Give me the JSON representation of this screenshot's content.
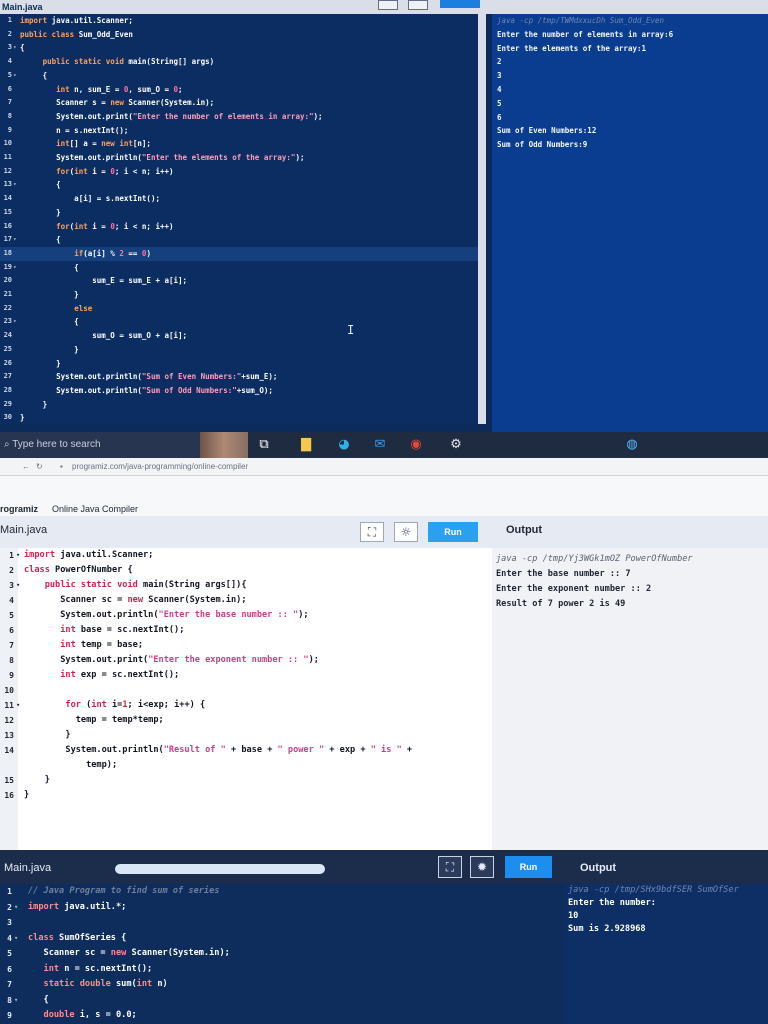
{
  "panel1": {
    "file_tab": "Main.java",
    "code": [
      {
        "n": "1",
        "fold": "",
        "t": [
          [
            "kw",
            "import"
          ],
          [
            "plain",
            " java.util.Scanner;"
          ]
        ]
      },
      {
        "n": "2",
        "fold": "",
        "t": [
          [
            "kw",
            "public class"
          ],
          [
            "plain",
            " Sum_Odd_Even"
          ]
        ]
      },
      {
        "n": "3",
        "fold": "▾",
        "t": [
          [
            "plain",
            "{"
          ]
        ]
      },
      {
        "n": "4",
        "fold": "",
        "t": [
          [
            "plain",
            "     "
          ],
          [
            "kw",
            "public static void"
          ],
          [
            "plain",
            " main(String[] args)"
          ]
        ]
      },
      {
        "n": "5",
        "fold": "▾",
        "t": [
          [
            "plain",
            "     {"
          ]
        ]
      },
      {
        "n": "6",
        "fold": "",
        "t": [
          [
            "plain",
            "        "
          ],
          [
            "kw",
            "int"
          ],
          [
            "plain",
            " n, sum_E = "
          ],
          [
            "num",
            "0"
          ],
          [
            "plain",
            ", sum_O = "
          ],
          [
            "num",
            "0"
          ],
          [
            "plain",
            ";"
          ]
        ]
      },
      {
        "n": "7",
        "fold": "",
        "t": [
          [
            "plain",
            "        Scanner s = "
          ],
          [
            "kw",
            "new"
          ],
          [
            "plain",
            " Scanner(System.in);"
          ]
        ]
      },
      {
        "n": "8",
        "fold": "",
        "t": [
          [
            "plain",
            "        System.out.print("
          ],
          [
            "str",
            "\"Enter the number of elements in array:\""
          ],
          [
            "plain",
            ");"
          ]
        ]
      },
      {
        "n": "9",
        "fold": "",
        "t": [
          [
            "plain",
            "        n = s.nextInt();"
          ]
        ]
      },
      {
        "n": "10",
        "fold": "",
        "t": [
          [
            "plain",
            "        "
          ],
          [
            "kw",
            "int"
          ],
          [
            "plain",
            "[] a = "
          ],
          [
            "kw",
            "new int"
          ],
          [
            "plain",
            "[n];"
          ]
        ]
      },
      {
        "n": "11",
        "fold": "",
        "t": [
          [
            "plain",
            "        System.out.println("
          ],
          [
            "str",
            "\"Enter the elements of the array:\""
          ],
          [
            "plain",
            ");"
          ]
        ]
      },
      {
        "n": "12",
        "fold": "",
        "t": [
          [
            "plain",
            "        "
          ],
          [
            "kw",
            "for"
          ],
          [
            "plain",
            "("
          ],
          [
            "kw",
            "int"
          ],
          [
            "plain",
            " i = "
          ],
          [
            "num",
            "0"
          ],
          [
            "plain",
            "; i < n; i++)"
          ]
        ]
      },
      {
        "n": "13",
        "fold": "▾",
        "t": [
          [
            "plain",
            "        {"
          ]
        ]
      },
      {
        "n": "14",
        "fold": "",
        "t": [
          [
            "plain",
            "            a[i] = s.nextInt();"
          ]
        ]
      },
      {
        "n": "15",
        "fold": "",
        "t": [
          [
            "plain",
            "        }"
          ]
        ]
      },
      {
        "n": "16",
        "fold": "",
        "t": [
          [
            "plain",
            "        "
          ],
          [
            "kw",
            "for"
          ],
          [
            "plain",
            "("
          ],
          [
            "kw",
            "int"
          ],
          [
            "plain",
            " i = "
          ],
          [
            "num",
            "0"
          ],
          [
            "plain",
            "; i < n; i++)"
          ]
        ]
      },
      {
        "n": "17",
        "fold": "▾",
        "t": [
          [
            "plain",
            "        {"
          ]
        ]
      },
      {
        "n": "18",
        "fold": "",
        "active": true,
        "t": [
          [
            "plain",
            "            "
          ],
          [
            "kw",
            "if"
          ],
          [
            "plain",
            "(a[i] % "
          ],
          [
            "num",
            "2"
          ],
          [
            "plain",
            " == "
          ],
          [
            "num",
            "0"
          ],
          [
            "plain",
            ")"
          ]
        ]
      },
      {
        "n": "19",
        "fold": "▾",
        "t": [
          [
            "plain",
            "            {"
          ]
        ]
      },
      {
        "n": "20",
        "fold": "",
        "t": [
          [
            "plain",
            "                sum_E = sum_E + a[i];"
          ]
        ]
      },
      {
        "n": "21",
        "fold": "",
        "t": [
          [
            "plain",
            "            }"
          ]
        ]
      },
      {
        "n": "22",
        "fold": "",
        "t": [
          [
            "plain",
            "            "
          ],
          [
            "kw",
            "else"
          ]
        ]
      },
      {
        "n": "23",
        "fold": "▾",
        "t": [
          [
            "plain",
            "            {"
          ]
        ]
      },
      {
        "n": "24",
        "fold": "",
        "t": [
          [
            "plain",
            "                sum_O = sum_O + a[i];"
          ]
        ]
      },
      {
        "n": "25",
        "fold": "",
        "t": [
          [
            "plain",
            "            }"
          ]
        ]
      },
      {
        "n": "26",
        "fold": "",
        "t": [
          [
            "plain",
            "        }"
          ]
        ]
      },
      {
        "n": "27",
        "fold": "",
        "t": [
          [
            "plain",
            "        System.out.println("
          ],
          [
            "str",
            "\"Sum of Even Numbers:\""
          ],
          [
            "plain",
            "+sum_E);"
          ]
        ]
      },
      {
        "n": "28",
        "fold": "",
        "t": [
          [
            "plain",
            "        System.out.println("
          ],
          [
            "str",
            "\"Sum of Odd Numbers:\""
          ],
          [
            "plain",
            "+sum_O);"
          ]
        ]
      },
      {
        "n": "29",
        "fold": "",
        "t": [
          [
            "plain",
            "     }"
          ]
        ]
      },
      {
        "n": "30",
        "fold": "",
        "t": [
          [
            "plain",
            "}"
          ]
        ]
      }
    ],
    "output": [
      {
        "cls": "cmd",
        "text": "java -cp /tmp/TWMdxxucDh Sum_Odd_Even"
      },
      {
        "cls": "",
        "text": "Enter the number of elements in array:6"
      },
      {
        "cls": "",
        "text": "Enter the elements of the array:1"
      },
      {
        "cls": "",
        "text": "2"
      },
      {
        "cls": "",
        "text": "3"
      },
      {
        "cls": "",
        "text": "4"
      },
      {
        "cls": "",
        "text": "5"
      },
      {
        "cls": "",
        "text": "6"
      },
      {
        "cls": "",
        "text": "Sum of Even Numbers:12"
      },
      {
        "cls": "",
        "text": "Sum of Odd Numbers:9"
      }
    ]
  },
  "taskbar": {
    "search_placeholder": "Type here to search",
    "search_icon": "⌕",
    "icons": [
      {
        "name": "task-view-icon",
        "glyph": "⧉",
        "color": "#ffffff"
      },
      {
        "name": "file-explorer-icon",
        "glyph": "▇",
        "color": "#f2c94c"
      },
      {
        "name": "edge-icon",
        "glyph": "◕",
        "color": "#2fb3e6"
      },
      {
        "name": "mail-icon",
        "glyph": "✉",
        "color": "#3a9bf0"
      },
      {
        "name": "chrome-icon",
        "glyph": "◉",
        "color": "#e8453c"
      },
      {
        "name": "settings-icon",
        "glyph": "⚙",
        "color": "#e6e6e6"
      },
      {
        "name": "weather-icon",
        "glyph": "◍",
        "color": "#5ab8ff"
      }
    ]
  },
  "panel2": {
    "url": "programiz.com/java-programming/online-compiler",
    "brand": "rogramiz",
    "title": "Online Java Compiler",
    "file_tab": "Main.java",
    "run_label": "Run",
    "output_title": "Output",
    "code": [
      {
        "n": "1",
        "fold": "▾",
        "t": [
          [
            "kw",
            "import"
          ],
          [
            "plain",
            " java.util.Scanner;"
          ]
        ]
      },
      {
        "n": "2",
        "fold": "",
        "t": [
          [
            "kw",
            "class"
          ],
          [
            "plain",
            " PowerOfNumber {"
          ]
        ]
      },
      {
        "n": "3",
        "fold": "▾",
        "t": [
          [
            "plain",
            "    "
          ],
          [
            "kw",
            "public static void"
          ],
          [
            "plain",
            " main(String args[]){"
          ]
        ]
      },
      {
        "n": "4",
        "fold": "",
        "t": [
          [
            "plain",
            "       Scanner sc = "
          ],
          [
            "kw",
            "new"
          ],
          [
            "plain",
            " Scanner(System.in);"
          ]
        ]
      },
      {
        "n": "5",
        "fold": "",
        "t": [
          [
            "plain",
            "       System.out.println("
          ],
          [
            "str",
            "\"Enter the base number :: \""
          ],
          [
            "plain",
            ");"
          ]
        ]
      },
      {
        "n": "6",
        "fold": "",
        "t": [
          [
            "plain",
            "       "
          ],
          [
            "kw",
            "int"
          ],
          [
            "plain",
            " base = sc.nextInt();"
          ]
        ]
      },
      {
        "n": "7",
        "fold": "",
        "t": [
          [
            "plain",
            "       "
          ],
          [
            "kw",
            "int"
          ],
          [
            "plain",
            " temp = base;"
          ]
        ]
      },
      {
        "n": "8",
        "fold": "",
        "t": [
          [
            "plain",
            "       System.out.print("
          ],
          [
            "str",
            "\"Enter the exponent number :: \""
          ],
          [
            "plain",
            ");"
          ]
        ]
      },
      {
        "n": "9",
        "fold": "",
        "t": [
          [
            "plain",
            "       "
          ],
          [
            "kw",
            "int"
          ],
          [
            "plain",
            " exp = sc.nextInt();"
          ]
        ]
      },
      {
        "n": "10",
        "fold": "",
        "t": [
          [
            "plain",
            ""
          ]
        ]
      },
      {
        "n": "11",
        "fold": "▾",
        "t": [
          [
            "plain",
            "        "
          ],
          [
            "kw",
            "for"
          ],
          [
            "plain",
            " ("
          ],
          [
            "kw",
            "int"
          ],
          [
            "plain",
            " i="
          ],
          [
            "num",
            "1"
          ],
          [
            "plain",
            "; i<exp; i++) {"
          ]
        ]
      },
      {
        "n": "12",
        "fold": "",
        "t": [
          [
            "plain",
            "          temp = temp*temp;"
          ]
        ]
      },
      {
        "n": "13",
        "fold": "",
        "t": [
          [
            "plain",
            "        }"
          ]
        ]
      },
      {
        "n": "14",
        "fold": "",
        "t": [
          [
            "plain",
            "        System.out.println("
          ],
          [
            "str",
            "\"Result of \""
          ],
          [
            "plain",
            " + base + "
          ],
          [
            "str",
            "\" power \""
          ],
          [
            "plain",
            " + exp + "
          ],
          [
            "str",
            "\" is \""
          ],
          [
            "plain",
            " +"
          ]
        ]
      },
      {
        "n": "",
        "fold": "",
        "t": [
          [
            "plain",
            "            temp);"
          ]
        ]
      },
      {
        "n": "15",
        "fold": "",
        "t": [
          [
            "plain",
            "    }"
          ]
        ]
      },
      {
        "n": "16",
        "fold": "",
        "t": [
          [
            "plain",
            "}"
          ]
        ]
      }
    ],
    "output": [
      {
        "cls": "cmd",
        "text": "java -cp /tmp/Yj3WGk1mOZ PowerOfNumber"
      },
      {
        "cls": "",
        "text": "Enter the base number :: 7"
      },
      {
        "cls": "",
        "text": "Enter the exponent number :: 2"
      },
      {
        "cls": "",
        "text": "Result of 7 power 2 is 49"
      }
    ]
  },
  "panel3": {
    "file_tab": "Main.java",
    "run_label": "Run",
    "output_title": "Output",
    "code": [
      {
        "n": "1",
        "fold": "",
        "t": [
          [
            "cmt",
            "// Java Program to find sum of series"
          ]
        ]
      },
      {
        "n": "2",
        "fold": "▾",
        "t": [
          [
            "kw",
            "import"
          ],
          [
            "plain",
            " java.util.*;"
          ]
        ]
      },
      {
        "n": "3",
        "fold": "",
        "t": [
          [
            "plain",
            ""
          ]
        ]
      },
      {
        "n": "4",
        "fold": "▾",
        "t": [
          [
            "kw",
            "class"
          ],
          [
            "plain",
            " SumOfSeries {"
          ]
        ]
      },
      {
        "n": "5",
        "fold": "",
        "t": [
          [
            "plain",
            "   Scanner sc = "
          ],
          [
            "kw",
            "new"
          ],
          [
            "plain",
            " Scanner(System.in);"
          ]
        ]
      },
      {
        "n": "6",
        "fold": "",
        "t": [
          [
            "plain",
            "   "
          ],
          [
            "kw",
            "int"
          ],
          [
            "plain",
            " n = sc.nextInt();"
          ]
        ]
      },
      {
        "n": "7",
        "fold": "",
        "t": [
          [
            "plain",
            "   "
          ],
          [
            "kw",
            "static double"
          ],
          [
            "plain",
            " sum("
          ],
          [
            "kw",
            "int"
          ],
          [
            "plain",
            " n)"
          ]
        ]
      },
      {
        "n": "8",
        "fold": "▾",
        "t": [
          [
            "plain",
            "   {"
          ]
        ]
      },
      {
        "n": "9",
        "fold": "",
        "t": [
          [
            "plain",
            "   "
          ],
          [
            "kw",
            "double"
          ],
          [
            "plain",
            " i, s = 0.0;"
          ]
        ]
      }
    ],
    "output": [
      {
        "cls": "cmd",
        "text": "java -cp /tmp/SHx9bdfSER SumOfSer"
      },
      {
        "cls": "",
        "text": "Enter the number:"
      },
      {
        "cls": "",
        "text": "10"
      },
      {
        "cls": "",
        "text": "Sum is 2.928968"
      }
    ]
  }
}
